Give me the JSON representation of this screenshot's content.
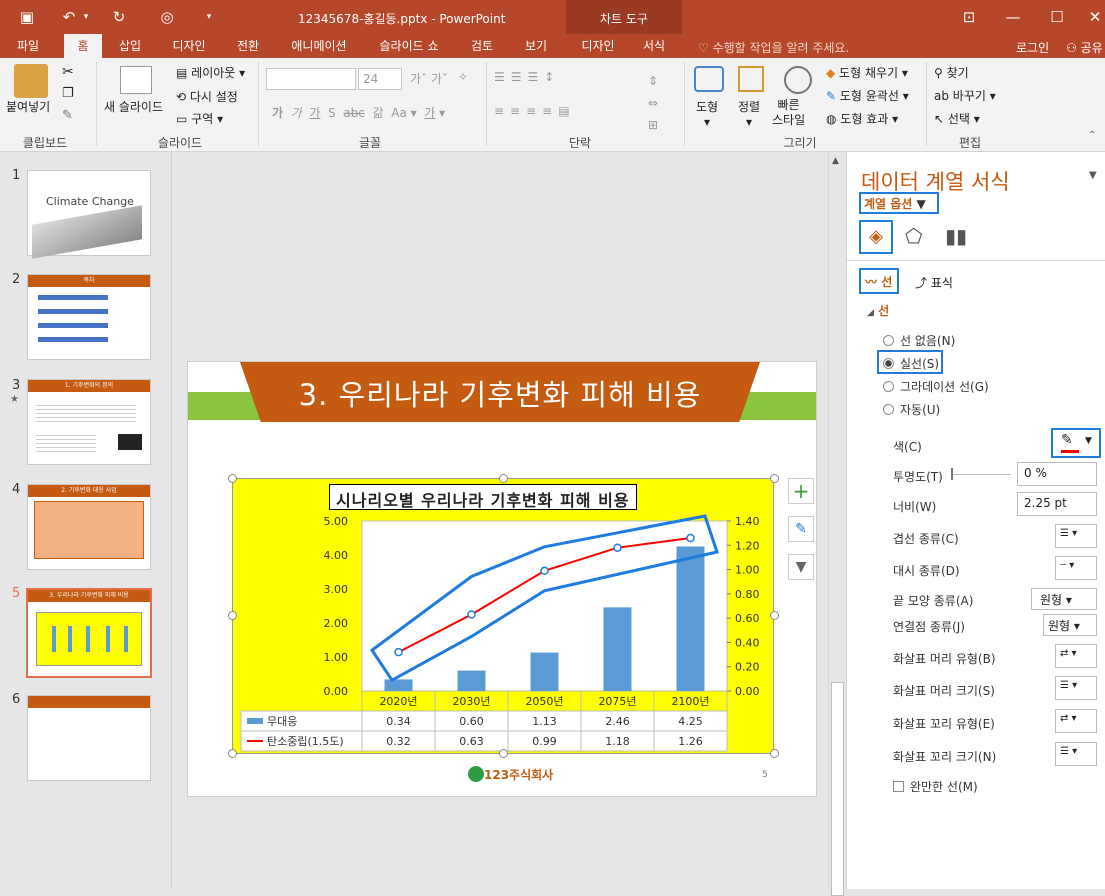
{
  "window": {
    "title": "12345678-홍길동.pptx - PowerPoint",
    "context_tab": "차트 도구"
  },
  "tabs": [
    "파일",
    "홈",
    "삽입",
    "디자인",
    "전환",
    "애니메이션",
    "슬라이드 쇼",
    "검토",
    "보기",
    "디자인",
    "서식"
  ],
  "tell_me": "수행할 작업을 알려 주세요.",
  "login": "로그인",
  "share": "공유",
  "ribbon": {
    "clipboard": {
      "paste": "붙여넣기",
      "label": "클립보드"
    },
    "slides": {
      "new_slide": "새 슬라이드",
      "layout": "레이아웃",
      "reset": "다시 설정",
      "section": "구역",
      "label": "슬라이드"
    },
    "font": {
      "size": "24",
      "label": "글꼴",
      "glyphs": [
        "가",
        "가",
        "가",
        "S",
        "abc",
        "갊",
        "Aa",
        "가"
      ]
    },
    "paragraph": {
      "label": "단락"
    },
    "drawing": {
      "shape": "도형",
      "arrange": "정렬",
      "quick_style": "빠른\n스타일",
      "fill": "도형 채우기",
      "outline": "도형 윤곽선",
      "effect": "도형 효과",
      "label": "그리기"
    },
    "editing": {
      "find": "찾기",
      "replace": "바꾸기",
      "select": "선택",
      "label": "편집"
    }
  },
  "thumbnails": [
    {
      "num": "1",
      "title": "Climate Change"
    },
    {
      "num": "2",
      "title": "목차"
    },
    {
      "num": "3",
      "title": "1. 기후변화의 정의"
    },
    {
      "num": "4",
      "title": "2. 기후변화 대응 사업"
    },
    {
      "num": "5",
      "title": "3. 우리나라 기후변화 피해 비용"
    },
    {
      "num": "6",
      "title": ""
    }
  ],
  "slide": {
    "title": "3. 우리나라 기후변화 피해 비용",
    "page": "5",
    "logo": "123주식회사"
  },
  "chart_data": {
    "type": "bar",
    "title": "시나리오별 우리나라 기후변화 피해 비용",
    "categories": [
      "2020년",
      "2030년",
      "2050년",
      "2075년",
      "2100년"
    ],
    "series": [
      {
        "name": "무대응",
        "type": "bar",
        "axis": "left",
        "values": [
          0.34,
          0.6,
          1.13,
          2.46,
          4.25
        ],
        "color": "#5b9bd5"
      },
      {
        "name": "탄소중립(1.5도)",
        "type": "line",
        "axis": "right",
        "values": [
          0.32,
          0.63,
          0.99,
          1.18,
          1.26
        ],
        "color": "#ff0000"
      }
    ],
    "y_left": {
      "ticks": [
        "0.00",
        "1.00",
        "2.00",
        "3.00",
        "4.00",
        "5.00"
      ],
      "min": 0,
      "max": 5
    },
    "y_right": {
      "ticks": [
        "0.00",
        "0.20",
        "0.40",
        "0.60",
        "0.80",
        "1.00",
        "1.20",
        "1.40"
      ],
      "min": 0,
      "max": 1.4
    },
    "table": [
      [
        "0.34",
        "0.60",
        "1.13",
        "2.46",
        "4.25"
      ],
      [
        "0.32",
        "0.63",
        "0.99",
        "1.18",
        "1.26"
      ]
    ],
    "background": "#ffff00"
  },
  "pane": {
    "title": "데이터 계열 서식",
    "series_options": "계열 옵션",
    "tab_line": "선",
    "tab_marker": "표식",
    "section": "선",
    "radios": [
      "선 없음(N)",
      "실선(S)",
      "그라데이션 선(G)",
      "자동(U)"
    ],
    "color_label": "색(C)",
    "transparency_label": "투명도(T)",
    "transparency": "0 %",
    "width_label": "너비(W)",
    "width": "2.25 pt",
    "compound_label": "겹선 종류(C)",
    "dash_label": "대시 종류(D)",
    "cap_label": "끝 모양 종류(A)",
    "cap": "원형",
    "join_label": "연결점 종류(J)",
    "join": "원형",
    "begin_type": "화살표 머리 유형(B)",
    "begin_size": "화살표 머리 크기(S)",
    "end_type": "화살표 꼬리 유형(E)",
    "end_size": "화살표 꼬리 크기(N)",
    "smooth": "완만한 선(M)"
  }
}
